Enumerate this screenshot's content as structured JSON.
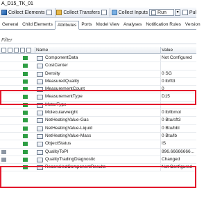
{
  "window": {
    "title": "A_D15_TK_01"
  },
  "toolbar": {
    "collect_elements": "Collect Elements",
    "collect_transfers": "Collect Transfers",
    "collect_inputs": "Collect Inputs",
    "run": "Run",
    "pul": "Pul"
  },
  "tabs": [
    "General",
    "Child Elements",
    "Attributes",
    "Ports",
    "Model View",
    "Analyses",
    "Notification Rules",
    "Version"
  ],
  "active_tab": "Attributes",
  "filter": {
    "placeholder": "Filter"
  },
  "grid": {
    "col_name": "Name",
    "col_value": "Value",
    "rows": [
      {
        "name": "ComponentData",
        "value": "Not Configured"
      },
      {
        "name": "CostCenter",
        "value": ""
      },
      {
        "name": "Density",
        "value": "0 SG"
      },
      {
        "name": "MeasuredQuality",
        "value": "0 lb/ft3"
      },
      {
        "name": "MeasurementCount",
        "value": "0"
      },
      {
        "name": "MeasurementType",
        "value": "D15"
      },
      {
        "name": "MeterType",
        "value": ""
      },
      {
        "name": "Molecularweight",
        "value": "0 lb/lbmol"
      },
      {
        "name": "NetHeatingValue-Gas",
        "value": "0 Btu/sft3"
      },
      {
        "name": "NetHeatingValue-Liquid",
        "value": "0 Btu/bbl"
      },
      {
        "name": "NetHeatingValue-Mass",
        "value": "0 Btu/lb"
      },
      {
        "name": "ObjectStatus",
        "value": "IS"
      },
      {
        "name": "QualityToPI",
        "value": "896.66666666..."
      },
      {
        "name": "QualityTradingDiagnostic",
        "value": "Changed"
      },
      {
        "name": "ReconciledComponentResults",
        "value": "Not Configured"
      }
    ]
  },
  "colors": {
    "highlight": "#e3162b",
    "status_green": "#2e9e44"
  }
}
